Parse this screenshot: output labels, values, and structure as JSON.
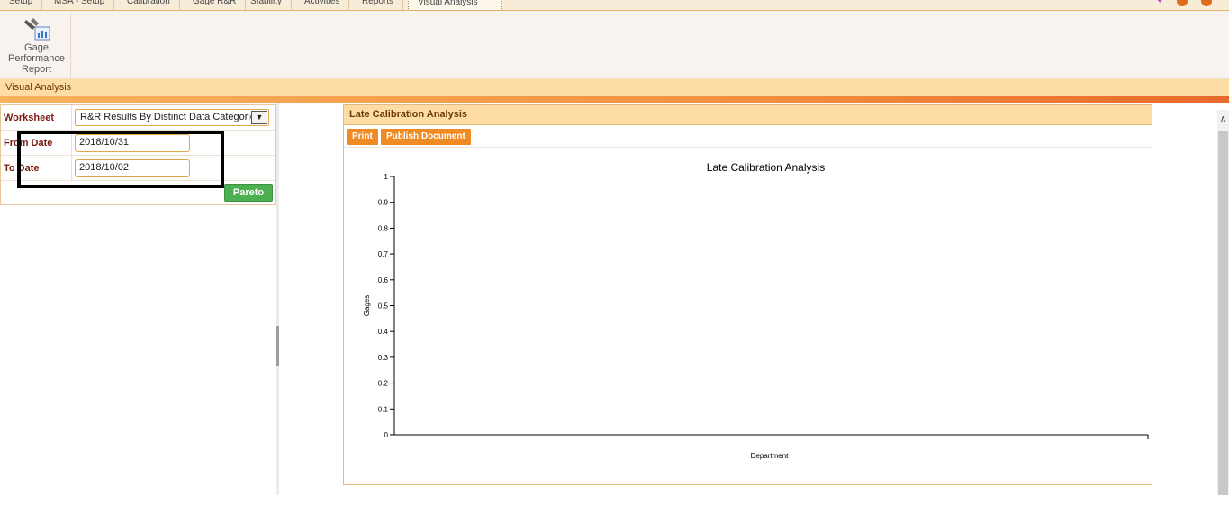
{
  "tabs": [
    {
      "label": "Setup",
      "active": false
    },
    {
      "label": "MSA - Setup",
      "active": false
    },
    {
      "label": "Calibration",
      "active": false
    },
    {
      "label": "Gage R&R",
      "active": false
    },
    {
      "label": "Stability",
      "active": false
    },
    {
      "label": "Activities",
      "active": false
    },
    {
      "label": "Reports",
      "active": false
    },
    {
      "label": "Visual Analysis",
      "active": true
    }
  ],
  "ribbon": {
    "button_line1": "Gage",
    "button_line2": "Performance",
    "button_line3": "Report",
    "button_icon": "gage-chart-icon",
    "group_label": "Visual Analysis"
  },
  "form": {
    "worksheet_label": "Worksheet",
    "worksheet_value": "R&R Results By Distinct Data Categories",
    "from_label": "From Date",
    "from_value": "2018/10/31",
    "to_label": "To Date",
    "to_value": "2018/10/02",
    "pareto_label": "Pareto"
  },
  "panel": {
    "title": "Late Calibration Analysis",
    "print_label": "Print",
    "publish_label": "Publish Document"
  },
  "colors": {
    "accent_orange": "#f08a24",
    "header_tan": "#fddca6",
    "label_maroon": "#7a1b12",
    "pareto_green": "#4caf50"
  },
  "chart_data": {
    "type": "bar",
    "title": "Late Calibration Analysis",
    "xlabel": "Department",
    "ylabel": "Gages",
    "categories": [],
    "values": [],
    "ylim": [
      0,
      1
    ],
    "yticks": [
      "0",
      "0.1",
      "0.2",
      "0.3",
      "0.4",
      "0.5",
      "0.6",
      "0.7",
      "0.8",
      "0.9",
      "1"
    ],
    "grid": false
  }
}
